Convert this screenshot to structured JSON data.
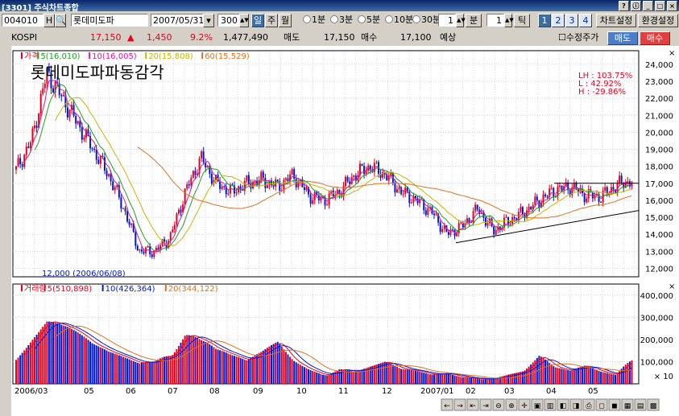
{
  "window": {
    "title": "[3301] 주식차트종합"
  },
  "toolbar": {
    "code": "004010",
    "h_button": "H",
    "name": "롯데미도파",
    "date": "2007/05/31",
    "count": "300",
    "periods": [
      "일",
      "주",
      "월"
    ],
    "radio_items": [
      "1분",
      "3분",
      "5분",
      "10분",
      "30분"
    ],
    "min_value": "1",
    "min_label": "분",
    "tick_value": "1",
    "tick_label": "틱",
    "pages": [
      "1",
      "2",
      "3",
      "4"
    ],
    "chart_settings": "차트설정",
    "env_settings": "환경설정"
  },
  "info": {
    "index": "KOSPI",
    "price": "17,150",
    "change": "1,450",
    "rate": "9.2%",
    "volume": "1,477,490",
    "ask_label": "매도",
    "ask": "17,150",
    "bid_label": "매수",
    "bid": "17,100",
    "forecast": "예상",
    "adjusted": "수정주가",
    "sell_button": "매도",
    "buy_button": "매수"
  },
  "colors": {
    "up": "#e8001c",
    "down": "#0018d8",
    "ma5": "#d81898",
    "ma10": "#20a020",
    "ma20": "#c8b400",
    "ma60": "#e07020",
    "accent": "#3a6ea5"
  },
  "chart": {
    "price_legend": [
      "가격",
      "5(16,010)",
      "10(16,005)",
      "20(15,808)",
      "60(15,529)"
    ],
    "overlay_title": "롯데미도파파동감각",
    "stats": [
      "LH : 103.75%",
      "L : 42.92%",
      "H : -29.86%"
    ],
    "low_annotation": "12,000 (2006/06/08)",
    "volume_legend": [
      "거래량",
      "5(510,898)",
      "10(426,364)",
      "20(344,122)"
    ],
    "volume_unit": "× 10",
    "x_labels": [
      "2006/03",
      "05",
      "06",
      "07",
      "08",
      "09",
      "10",
      "11",
      "12",
      "2007/01",
      "02",
      "03",
      "04",
      "05"
    ]
  },
  "chart_data": {
    "type": "candlestick",
    "price_axis": [
      "24,000",
      "23,000",
      "22,000",
      "21,000",
      "20,000",
      "19,000",
      "18,000",
      "17,000",
      "16,000",
      "15,000",
      "14,000",
      "13,000",
      "12,000"
    ],
    "volume_axis": [
      "400,000",
      "300,000",
      "200,000",
      "100,000"
    ],
    "ylim_price": [
      11500,
      24800
    ],
    "ylim_volume": [
      0,
      450000
    ],
    "series_close": [
      17800,
      19500,
      23500,
      22000,
      20500,
      19000,
      17500,
      15500,
      13000,
      13000,
      13800,
      16500,
      18500,
      17000,
      16500,
      17000,
      17200,
      16800,
      17500,
      16300,
      16000,
      16500,
      17500,
      18000,
      17500,
      16500,
      16000,
      15300,
      14000,
      14500,
      15500,
      14200,
      14800,
      15300,
      16000,
      16600,
      16800,
      16300,
      16200,
      16900,
      17150
    ],
    "series_volume": [
      180000,
      220000,
      250000,
      200000,
      160000,
      120000,
      100000,
      90000,
      80000,
      110000,
      200000,
      260000,
      180000,
      120000,
      90000,
      70000,
      100000,
      140000,
      90000,
      70000,
      60000,
      80000,
      50000,
      60000,
      70000,
      45000,
      40000,
      30000,
      40000,
      30000,
      35000,
      30000,
      40000,
      45000,
      90000,
      50000,
      40000,
      60000,
      45000,
      40000,
      148000
    ]
  }
}
